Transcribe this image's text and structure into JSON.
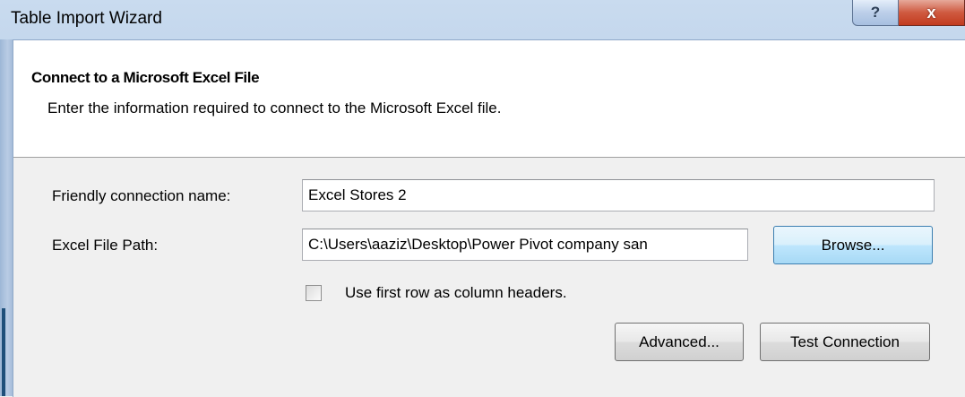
{
  "window": {
    "title": "Table Import Wizard",
    "help_glyph": "?",
    "close_glyph": "x"
  },
  "header": {
    "title": "Connect to a Microsoft Excel File",
    "description": "Enter the information required to connect to the Microsoft Excel file."
  },
  "form": {
    "friendly_name_label": "Friendly connection name:",
    "friendly_name_value": "Excel Stores 2",
    "file_path_label": "Excel File Path:",
    "file_path_value": "C:\\Users\\aaziz\\Desktop\\Power Pivot company san",
    "browse_label": "Browse...",
    "use_headers_label": "Use first row as column headers.",
    "use_headers_checked": false,
    "advanced_label": "Advanced...",
    "test_connection_label": "Test Connection"
  },
  "colors": {
    "title_bar": "#b7cde6",
    "close_button": "#c23b1f",
    "client_bg": "#f0f0f0",
    "browse_accent": "#3c7fb1"
  }
}
